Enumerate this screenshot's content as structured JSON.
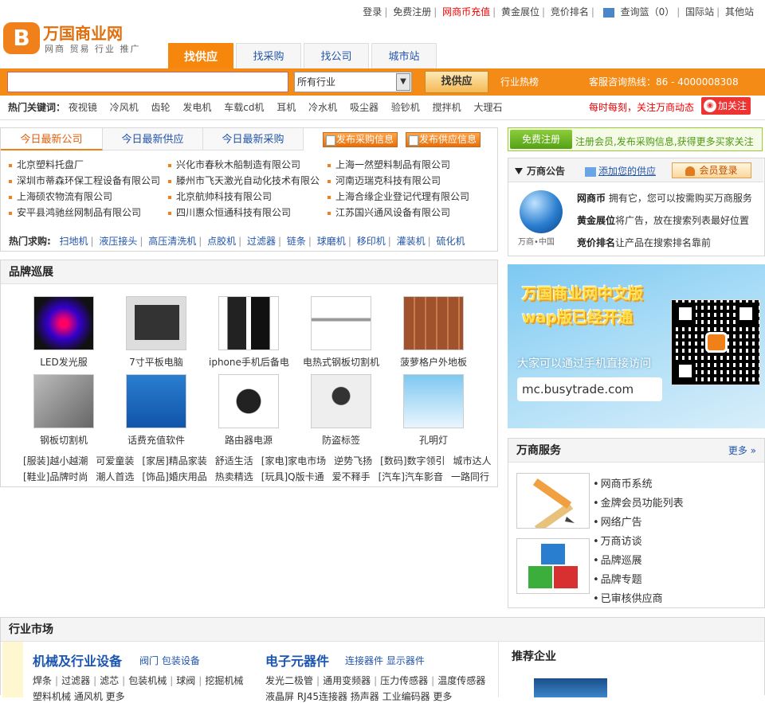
{
  "top_links": [
    "登录",
    "免费注册",
    "网商币充值",
    "黄金展位",
    "竞价排名",
    "查询篮（0）",
    "国际站",
    "其他站"
  ],
  "logo": {
    "name": "万国商业网",
    "sub": "网商 贸易 行业 推广"
  },
  "tabs": [
    "找供应",
    "找采购",
    "找公司",
    "城市站"
  ],
  "search": {
    "placeholder": "",
    "industry": "所有行业",
    "button": "找供应",
    "hot": "行业热榜",
    "hotline": "客服咨询热线：86 - 4000008308"
  },
  "hot_keywords": {
    "label": "热门关键词：",
    "items": [
      "夜视镜",
      "冷风机",
      "齿轮",
      "发电机",
      "车载cd机",
      "耳机",
      "冷水机",
      "吸尘器",
      "验钞机",
      "搅拌机",
      "大理石"
    ]
  },
  "promo": "每时每刻，关注万商动态",
  "follow": "加关注",
  "latest": {
    "tabs": [
      "今日最新公司",
      "今日最新供应",
      "今日最新采购"
    ],
    "buttons": [
      "发布采购信息",
      "发布供应信息"
    ],
    "companies": [
      [
        "北京塑料托盘厂",
        "兴化市春秋木船制造有限公司",
        "上海一然塑料制品有限公司"
      ],
      [
        "深圳市蒂森环保工程设备有限公司",
        "滕州市飞天激光自动化技术有限公",
        "河南迈瑞克科技有限公司"
      ],
      [
        "上海硕农物流有限公司",
        "北京航帅科技有限公司",
        "上海合缘企业登记代理有限公司"
      ],
      [
        "安平县鸿驰丝网制品有限公司",
        "四川惠众恒通科技有限公司",
        "江苏国兴通风设备有限公司"
      ]
    ],
    "hot_seek_label": "热门求购:",
    "hot_seek": [
      "扫地机",
      "液压接头",
      "高压清洗机",
      "点胶机",
      "过滤器",
      "链条",
      "球磨机",
      "移印机",
      "灌装机",
      "硫化机"
    ]
  },
  "brand": {
    "title": "品牌巡展",
    "items": [
      "LED发光服",
      "7寸平板电脑",
      "iphone手机后备电",
      "电热式钢板切割机",
      "菠萝格户外地板",
      "钢板切割机",
      "话费充值软件",
      "路由器电源",
      "防盗标签",
      "孔明灯"
    ],
    "rows": [
      [
        "[服装]越小越潮",
        "可爱童装",
        "[家居]精品家装",
        "舒适生活",
        "[家电]家电市场",
        "逆势飞扬",
        "[数码]数字领引",
        "城市达人"
      ],
      [
        "[鞋业]品牌时尚",
        "潮人首选",
        "[饰品]婚庆用品",
        "热卖精选",
        "[玩具]Q版卡通",
        "爱不释手",
        "[汽车]汽车影音",
        "一路同行"
      ]
    ]
  },
  "register": {
    "button": "免费注册",
    "text": "注册会员,发布采购信息,获得更多买家关注"
  },
  "announce": {
    "title": "万商公告",
    "add": "添加您的供应",
    "login": "会员登录",
    "globe_caption": "万商•中国",
    "lines": [
      {
        "bold": "网商币",
        "text": " 拥有它，您可以按需购买万商服务"
      },
      {
        "bold": "黄金展位",
        "text": "将广告，放在搜索列表最好位置"
      },
      {
        "bold": "竞价排名",
        "text": "让产品在搜索排名靠前"
      }
    ]
  },
  "wap": {
    "line1": "万国商业网中文版",
    "line2": "wap版已经开通",
    "line3": "大家可以通过手机直接访问",
    "url": "mc.busytrade.com"
  },
  "services": {
    "title": "万商服务",
    "more": "更多 »",
    "links": [
      "网商币系统",
      "金牌会员功能列表",
      "网络广告",
      "万商访谈",
      "品牌巡展",
      "品牌专题",
      "已审核供应商"
    ]
  },
  "industry": {
    "title": "行业市场",
    "cat1": "机械及行业设备",
    "cat1_subs": "阀门  包装设备",
    "cat1_row1": [
      "焊条",
      "过滤器",
      "滤芯",
      "包装机械",
      "球阀",
      "挖掘机械"
    ],
    "cat1_row2": "塑料机械  通风机  更多",
    "cat2": "电子元器件",
    "cat2_subs": "连接器件  显示器件",
    "cat2_row1": [
      "发光二极管",
      "通用变频器",
      "压力传感器",
      "温度传感器"
    ],
    "cat2_row2": "液晶屏  RJ45连接器  扬声器  工业编码器  更多",
    "recommend": "推荐企业"
  },
  "colors": {
    "brand_orange": "#f58b17",
    "link_blue": "#2255aa",
    "alert_red": "#ee0000",
    "reg_green": "#54a116"
  }
}
